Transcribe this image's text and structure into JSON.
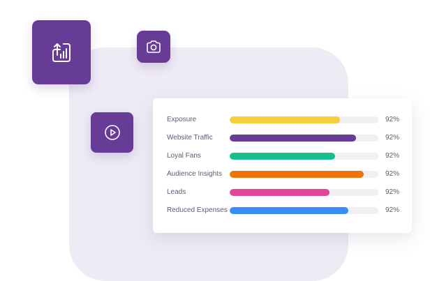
{
  "colors": {
    "background_panel": "#eeebf5",
    "tile": "#663c96",
    "card": "#ffffff",
    "track": "#f0eff4",
    "text": "#5d5a78"
  },
  "icons": {
    "stats_tile": "upload-chart-icon",
    "camera_tile": "camera-icon",
    "play_tile": "play-icon"
  },
  "stats": [
    {
      "label": "Exposure",
      "value": "92%",
      "fill_fraction": 0.74,
      "color": "#f6cd3c"
    },
    {
      "label": "Website Traffic",
      "value": "92%",
      "fill_fraction": 0.85,
      "color": "#663c96"
    },
    {
      "label": "Loyal Fans",
      "value": "92%",
      "fill_fraction": 0.71,
      "color": "#17bd8c"
    },
    {
      "label": "Audience Insights",
      "value": "92%",
      "fill_fraction": 0.9,
      "color": "#ee7407"
    },
    {
      "label": "Leads",
      "value": "92%",
      "fill_fraction": 0.67,
      "color": "#e0479a"
    },
    {
      "label": "Reduced Expenses",
      "value": "92%",
      "fill_fraction": 0.8,
      "color": "#3a8cf8"
    }
  ]
}
